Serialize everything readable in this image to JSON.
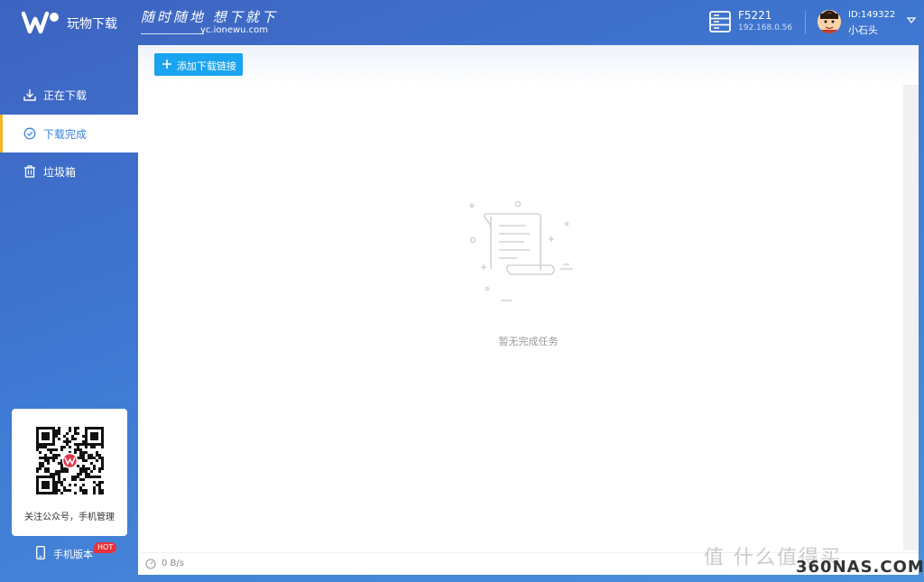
{
  "header": {
    "app_name": "玩物下载",
    "slogan": "随时随地 想下就下",
    "slogan_url": "yc.ionewu.com",
    "server": {
      "name": "F5221",
      "ip": "192.168.0.56"
    },
    "user": {
      "id": "ID:149322",
      "name": "小石头"
    }
  },
  "sidebar": {
    "items": [
      {
        "label": "正在下载",
        "icon": "download-icon",
        "active": false
      },
      {
        "label": "下载完成",
        "icon": "check-circle-icon",
        "active": true
      },
      {
        "label": "垃圾箱",
        "icon": "trash-icon",
        "active": false
      }
    ],
    "qr_caption": "关注公众号，手机管理",
    "mobile_label": "手机版本",
    "hot_badge": "HOT"
  },
  "main": {
    "add_button_label": "添加下载链接",
    "empty_text": "暂无完成任务",
    "speed": "0 B/s"
  },
  "watermark": {
    "line1": "值 什么值得买",
    "line2": "360NAS.COM"
  },
  "colors": {
    "accent": "#1aa3ef",
    "active_bar": "#f5b320",
    "hot": "#e8313a",
    "header_bg": "#3d63c0"
  }
}
